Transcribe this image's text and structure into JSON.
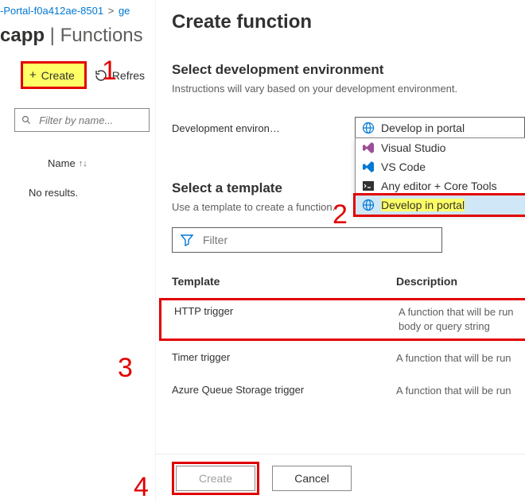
{
  "breadcrumb": {
    "item1": "-Portal-f0a412ae-8501",
    "sep": ">",
    "item2": "ge"
  },
  "pageTitle": {
    "main": "capp",
    "sep": " | ",
    "sub": "Functions"
  },
  "toolbar": {
    "create": "Create",
    "refresh": "Refres"
  },
  "search": {
    "placeholder": "Filter by name..."
  },
  "list": {
    "colName": "Name",
    "sort": "↑↓",
    "empty": "No results."
  },
  "blade": {
    "title": "Create function",
    "envHeading": "Select development environment",
    "envSub": "Instructions will vary based on your development environment.",
    "envLabel": "Development environ…",
    "envSelected": "Develop in portal",
    "envOptions": [
      "Visual Studio",
      "VS Code",
      "Any editor + Core Tools",
      "Develop in portal"
    ],
    "tmplHeading": "Select a template",
    "tmplSub": "Use a template to create a function.",
    "filterPlaceholder": "Filter",
    "tmplCols": {
      "c1": "Template",
      "c2": "Description"
    },
    "templates": [
      {
        "name": "HTTP trigger",
        "desc": "A function that will be run body or query string"
      },
      {
        "name": "Timer trigger",
        "desc": "A function that will be run"
      },
      {
        "name": "Azure Queue Storage trigger",
        "desc": "A function that will be run"
      }
    ],
    "footer": {
      "create": "Create",
      "cancel": "Cancel"
    }
  },
  "steps": {
    "s1": "1",
    "s2": "2",
    "s3": "3",
    "s4": "4"
  }
}
